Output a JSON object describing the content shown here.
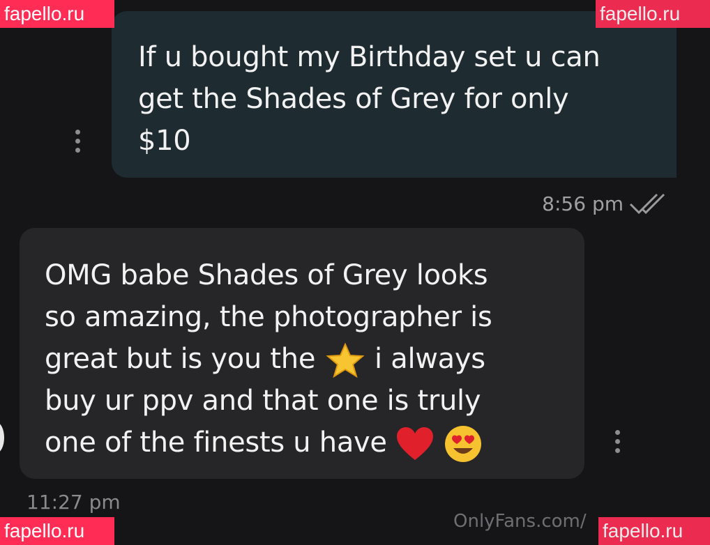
{
  "watermarks": {
    "top_left": "fapello.ru",
    "top_right": "fapello.ru",
    "bottom_left": "fapello.ru",
    "bottom_right": "fapello.ru"
  },
  "messages": [
    {
      "direction": "outgoing",
      "text_lines": [
        "If u bought my Birthday set u can",
        "get the Shades of Grey for only",
        "$10"
      ],
      "time": "8:56 pm",
      "status_icon": "double-check-icon"
    },
    {
      "direction": "incoming",
      "text_lines": [
        "OMG babe Shades of Grey looks",
        "so amazing, the photographer is",
        "great but is you the",
        "i always",
        "buy ur ppv and that one is truly",
        "one of the finests u have"
      ],
      "emojis": [
        "star-emoji",
        "red-heart-emoji",
        "heart-eyes-emoji"
      ],
      "time": "11:27 pm"
    }
  ],
  "footer": {
    "url_text": "OnlyFans.com/"
  },
  "colors": {
    "background": "#151517",
    "outgoing_bubble": "#1e2b30",
    "incoming_bubble": "#262628",
    "watermark": "#ff2d55"
  }
}
